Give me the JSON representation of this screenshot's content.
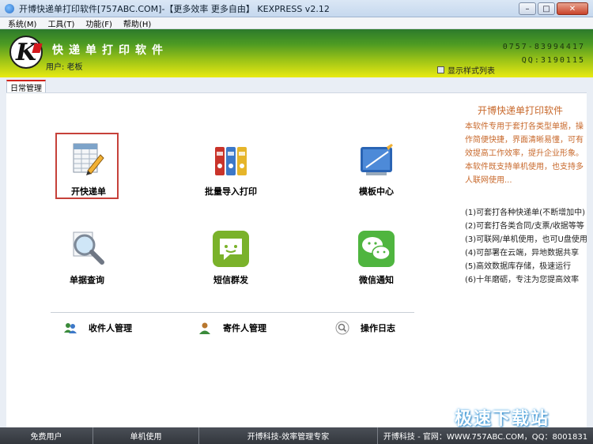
{
  "window": {
    "title": "开博快递单打印软件[757ABC.COM]-【更多效率 更多自由】  KEXPRESS v2.12",
    "min_label": "–",
    "max_label": "□",
    "close_label": "✕"
  },
  "menu": [
    "系统(M)",
    "工具(T)",
    "功能(F)",
    "帮助(H)"
  ],
  "header": {
    "logo_letter": "K",
    "brand": "快递单打印软件",
    "user": "用户: 老板",
    "phone": "0757-83994417",
    "qq": "QQ:3190115",
    "style_list": "显示样式列表"
  },
  "tab": "日常管理",
  "tiles": {
    "open_waybill": "开快递单",
    "batch_import": "批量导入打印",
    "template_center": "模板中心",
    "bill_query": "单据查询",
    "sms_group": "短信群发",
    "wechat_notify": "微信通知"
  },
  "links": {
    "recipient": "收件人管理",
    "sender": "寄件人管理",
    "log": "操作日志"
  },
  "side": {
    "title": "开博快递单打印软件",
    "desc": "本软件专用于套打各类型单据，操作简便快捷，界面清晰易懂，可有效提高工作效率，提升企业形象。本软件既支持单机使用，也支持多人联网使用...",
    "features": [
      "(1)可套打各种快递单(不断增加中)",
      "(2)可套打各类合同/支票/收据等等",
      "(3)可联网/单机使用，也可U盘使用",
      "(4)可部署在云端，异地数据共享",
      "(5)高效数据库存储，极速运行",
      "(6)十年磨砺，专注为您提高效率"
    ]
  },
  "status": {
    "s1": "免费用户",
    "s2": "单机使用",
    "s3": "开博科技-效率管理专家",
    "s4": "开博科技 - 官网：WWW.757ABC.COM，QQ：8001831"
  },
  "watermark": "极速下载站",
  "colors": {
    "accent_red": "#c6413a",
    "side_orange": "#c8692c",
    "header_green": "#4c9a23",
    "header_yellow": "#e9ea12"
  }
}
